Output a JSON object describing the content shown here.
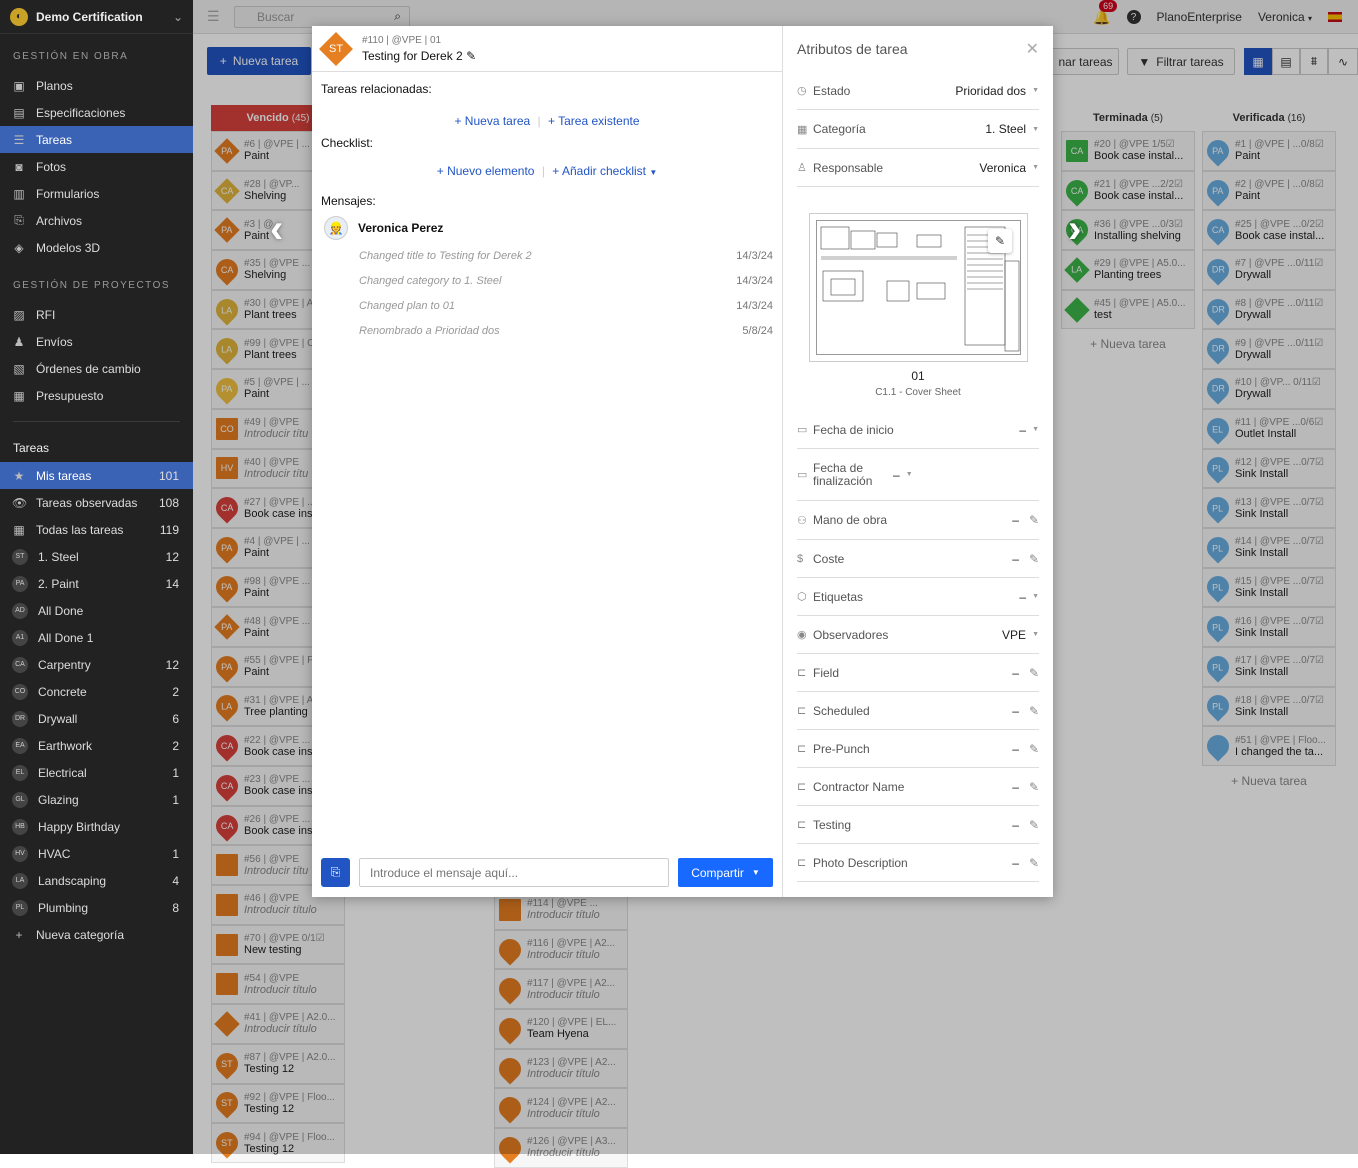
{
  "app": {
    "title": "Demo Certification"
  },
  "sidebar": {
    "sections": [
      {
        "title": "GESTIÓN EN OBRA",
        "items": [
          {
            "label": "Planos",
            "icon": "plans-icon"
          },
          {
            "label": "Especificaciones",
            "icon": "specs-icon"
          },
          {
            "label": "Tareas",
            "icon": "tasks-icon",
            "active": true
          },
          {
            "label": "Fotos",
            "icon": "camera-icon"
          },
          {
            "label": "Formularios",
            "icon": "forms-icon"
          },
          {
            "label": "Archivos",
            "icon": "paperclip-icon"
          },
          {
            "label": "Modelos 3D",
            "icon": "cube-icon"
          }
        ]
      },
      {
        "title": "GESTIÓN DE PROYECTOS",
        "items": [
          {
            "label": "RFI",
            "icon": "rfi-icon"
          },
          {
            "label": "Envíos",
            "icon": "user-icon"
          },
          {
            "label": "Órdenes de cambio",
            "icon": "change-order-icon"
          },
          {
            "label": "Presupuesto",
            "icon": "calculator-icon"
          }
        ]
      }
    ],
    "tasks_title": "Tareas",
    "task_filters": [
      {
        "label": "Mis tareas",
        "count": "101",
        "active": true,
        "icon": "★"
      },
      {
        "label": "Tareas observadas",
        "count": "108",
        "icon": "👁"
      },
      {
        "label": "Todas las tareas",
        "count": "119",
        "icon": "▦"
      }
    ],
    "categories": [
      {
        "abbr": "ST",
        "label": "1. Steel",
        "count": "12"
      },
      {
        "abbr": "PA",
        "label": "2. Paint",
        "count": "14"
      },
      {
        "abbr": "AD",
        "label": "All Done",
        "count": ""
      },
      {
        "abbr": "A1",
        "label": "All Done 1",
        "count": ""
      },
      {
        "abbr": "CA",
        "label": "Carpentry",
        "count": "12"
      },
      {
        "abbr": "CO",
        "label": "Concrete",
        "count": "2"
      },
      {
        "abbr": "DR",
        "label": "Drywall",
        "count": "6"
      },
      {
        "abbr": "EA",
        "label": "Earthwork",
        "count": "2"
      },
      {
        "abbr": "EL",
        "label": "Electrical",
        "count": "1"
      },
      {
        "abbr": "GL",
        "label": "Glazing",
        "count": "1"
      },
      {
        "abbr": "HB",
        "label": "Happy Birthday",
        "count": ""
      },
      {
        "abbr": "HV",
        "label": "HVAC",
        "count": "1"
      },
      {
        "abbr": "LA",
        "label": "Landscaping",
        "count": "4"
      },
      {
        "abbr": "PL",
        "label": "Plumbing",
        "count": "8"
      }
    ],
    "new_category": "Nueva categoría"
  },
  "topbar": {
    "search_placeholder": "Buscar",
    "notifications": "69",
    "org": "PlanoEnterprise",
    "user": "Veronica"
  },
  "toolbar": {
    "new_task": "Nueva tarea",
    "order_tasks": "nar tareas",
    "filter_tasks": "Filtrar tareas"
  },
  "columns": [
    {
      "title": "Vencido",
      "count": "(45)",
      "red": true,
      "cards": [
        {
          "abbr": "PA",
          "shape": "diamond",
          "color": "#e67e22",
          "meta": "#6 | @VPE | ...",
          "name": "Paint"
        },
        {
          "abbr": "CA",
          "shape": "diamond",
          "color": "#e0b43c",
          "meta": "#28 | @VP...",
          "name": "Shelving"
        },
        {
          "abbr": "PA",
          "shape": "diamond",
          "color": "#e67e22",
          "meta": "#3 | @",
          "name": "Paint"
        },
        {
          "abbr": "CA",
          "shape": "circle",
          "color": "#e67e22",
          "meta": "#35 | @VPE ...",
          "name": "Shelving"
        },
        {
          "abbr": "LA",
          "shape": "circle",
          "color": "#e0b43c",
          "meta": "#30 | @VPE | A",
          "name": "Plant trees"
        },
        {
          "abbr": "LA",
          "shape": "circle",
          "color": "#e0b43c",
          "meta": "#99 | @VPE | C",
          "name": "Plant trees"
        },
        {
          "abbr": "PA",
          "shape": "circle",
          "color": "#f0c040",
          "meta": "#5 | @VPE | ...",
          "name": "Paint"
        },
        {
          "abbr": "CO",
          "shape": "square",
          "color": "#e67e22",
          "meta": "#49 | @VPE",
          "name": "Introducir títu",
          "italic": true
        },
        {
          "abbr": "HV",
          "shape": "square",
          "color": "#e67e22",
          "meta": "#40 | @VPE",
          "name": "Introducir títu",
          "italic": true
        },
        {
          "abbr": "CA",
          "shape": "circle",
          "color": "#d9403b",
          "meta": "#27 | @VPE | ...",
          "name": "Book case ins"
        },
        {
          "abbr": "PA",
          "shape": "circle",
          "color": "#e67e22",
          "meta": "#4 | @VPE | ...",
          "name": "Paint"
        },
        {
          "abbr": "PA",
          "shape": "circle",
          "color": "#e67e22",
          "meta": "#98 | @VPE ...",
          "name": "Paint"
        },
        {
          "abbr": "PA",
          "shape": "diamond",
          "color": "#e67e22",
          "meta": "#48 | @VPE ...",
          "name": "Paint"
        },
        {
          "abbr": "PA",
          "shape": "circle",
          "color": "#e67e22",
          "meta": "#55 | @VPE | F",
          "name": "Paint"
        },
        {
          "abbr": "LA",
          "shape": "circle",
          "color": "#e67e22",
          "meta": "#31 | @VPE | A",
          "name": "Tree planting"
        },
        {
          "abbr": "CA",
          "shape": "circle",
          "color": "#d9403b",
          "meta": "#22 | @VPE ...",
          "name": "Book case ins"
        },
        {
          "abbr": "CA",
          "shape": "circle",
          "color": "#d9403b",
          "meta": "#23 | @VPE ...",
          "name": "Book case ins"
        },
        {
          "abbr": "CA",
          "shape": "circle",
          "color": "#d9403b",
          "meta": "#26 | @VPE ...",
          "name": "Book case ins"
        },
        {
          "abbr": "",
          "shape": "square",
          "color": "#e67e22",
          "meta": "#56 | @VPE",
          "name": "Introducir títu",
          "italic": true
        },
        {
          "abbr": "",
          "shape": "square",
          "color": "#e67e22",
          "meta": "#46 | @VPE",
          "name": "Introducir título",
          "italic": true
        },
        {
          "abbr": "",
          "shape": "square",
          "color": "#e67e22",
          "meta": "#70 | @VPE    0/1☑",
          "name": "New testing"
        },
        {
          "abbr": "",
          "shape": "square",
          "color": "#e67e22",
          "meta": "#54 | @VPE",
          "name": "Introducir título",
          "italic": true
        },
        {
          "abbr": "",
          "shape": "diamond",
          "color": "#e67e22",
          "meta": "#41 | @VPE | A2.0...",
          "name": "Introducir título",
          "italic": true
        },
        {
          "abbr": "ST",
          "shape": "circle",
          "color": "#e67e22",
          "meta": "#87 | @VPE | A2.0...",
          "name": "Testing 12"
        },
        {
          "abbr": "ST",
          "shape": "circle",
          "color": "#e67e22",
          "meta": "#92 | @VPE | Floo...",
          "name": "Testing 12"
        },
        {
          "abbr": "ST",
          "shape": "circle",
          "color": "#e67e22",
          "meta": "#94 | @VPE | Floo...",
          "name": "Testing 12"
        }
      ]
    },
    {
      "title": "",
      "count": "",
      "red": false,
      "cards": [
        {
          "abbr": "",
          "shape": "square",
          "color": "#e67e22",
          "meta": "#114 | @VPE ...",
          "name": "Introducir título",
          "italic": true
        },
        {
          "abbr": "",
          "shape": "circle",
          "color": "#e67e22",
          "meta": "#116 | @VPE | A2...",
          "name": "Introducir título",
          "italic": true
        },
        {
          "abbr": "",
          "shape": "circle",
          "color": "#e67e22",
          "meta": "#117 | @VPE | A2...",
          "name": "Introducir título",
          "italic": true
        },
        {
          "abbr": "",
          "shape": "circle",
          "color": "#e67e22",
          "meta": "#120 | @VPE | EL...",
          "name": "Team Hyena"
        },
        {
          "abbr": "",
          "shape": "circle",
          "color": "#e67e22",
          "meta": "#123 | @VPE | A2...",
          "name": "Introducir título",
          "italic": true
        },
        {
          "abbr": "",
          "shape": "circle",
          "color": "#e67e22",
          "meta": "#124 | @VPE | A2...",
          "name": "Introducir título",
          "italic": true
        },
        {
          "abbr": "",
          "shape": "circle",
          "color": "#e67e22",
          "meta": "#126 | @VPE | A3...",
          "name": "Introducir título",
          "italic": true
        }
      ]
    },
    {
      "title": "Terminada",
      "count": "(5)",
      "red": false,
      "cards": [
        {
          "abbr": "CA",
          "shape": "square",
          "color": "#3bb54a",
          "meta": "#20 | @VPE    1/5☑",
          "name": "Book case instal..."
        },
        {
          "abbr": "CA",
          "shape": "circle",
          "color": "#3bb54a",
          "meta": "#21 | @VPE ...2/2☑",
          "name": "Book case instal..."
        },
        {
          "abbr": "CA",
          "shape": "circle",
          "color": "#3bb54a",
          "meta": "#36 | @VPE ...0/3☑",
          "name": "Installing shelving"
        },
        {
          "abbr": "LA",
          "shape": "diamond",
          "color": "#3bb54a",
          "meta": "#29 | @VPE | A5.0...",
          "name": "Planting trees"
        },
        {
          "abbr": "",
          "shape": "diamond",
          "color": "#3bb54a",
          "meta": "#45 | @VPE | A5.0...",
          "name": "test"
        }
      ],
      "add": "+ Nueva tarea"
    },
    {
      "title": "Verificada",
      "count": "(16)",
      "red": false,
      "cards": [
        {
          "abbr": "PA",
          "shape": "circle",
          "color": "#6aaee0",
          "meta": "#1 | @VPE | ...0/8☑",
          "name": "Paint"
        },
        {
          "abbr": "PA",
          "shape": "circle",
          "color": "#6aaee0",
          "meta": "#2 | @VPE | ...0/8☑",
          "name": "Paint"
        },
        {
          "abbr": "CA",
          "shape": "circle",
          "color": "#6aaee0",
          "meta": "#25 | @VPE ...0/2☑",
          "name": "Book case instal..."
        },
        {
          "abbr": "DR",
          "shape": "circle",
          "color": "#6aaee0",
          "meta": "#7 | @VPE ...0/11☑",
          "name": "Drywall"
        },
        {
          "abbr": "DR",
          "shape": "circle",
          "color": "#6aaee0",
          "meta": "#8 | @VPE ...0/11☑",
          "name": "Drywall"
        },
        {
          "abbr": "DR",
          "shape": "circle",
          "color": "#6aaee0",
          "meta": "#9 | @VPE ...0/11☑",
          "name": "Drywall"
        },
        {
          "abbr": "DR",
          "shape": "circle",
          "color": "#6aaee0",
          "meta": "#10 | @VP... 0/11☑",
          "name": "Drywall"
        },
        {
          "abbr": "EL",
          "shape": "circle",
          "color": "#6aaee0",
          "meta": "#11 | @VPE ...0/6☑",
          "name": "Outlet Install"
        },
        {
          "abbr": "PL",
          "shape": "circle",
          "color": "#6aaee0",
          "meta": "#12 | @VPE ...0/7☑",
          "name": "Sink Install"
        },
        {
          "abbr": "PL",
          "shape": "circle",
          "color": "#6aaee0",
          "meta": "#13 | @VPE ...0/7☑",
          "name": "Sink Install"
        },
        {
          "abbr": "PL",
          "shape": "circle",
          "color": "#6aaee0",
          "meta": "#14 | @VPE ...0/7☑",
          "name": "Sink Install"
        },
        {
          "abbr": "PL",
          "shape": "circle",
          "color": "#6aaee0",
          "meta": "#15 | @VPE ...0/7☑",
          "name": "Sink Install"
        },
        {
          "abbr": "PL",
          "shape": "circle",
          "color": "#6aaee0",
          "meta": "#16 | @VPE ...0/7☑",
          "name": "Sink Install"
        },
        {
          "abbr": "PL",
          "shape": "circle",
          "color": "#6aaee0",
          "meta": "#17 | @VPE ...0/7☑",
          "name": "Sink Install"
        },
        {
          "abbr": "PL",
          "shape": "circle",
          "color": "#6aaee0",
          "meta": "#18 | @VPE ...0/7☑",
          "name": "Sink Install"
        },
        {
          "abbr": "",
          "shape": "circle",
          "color": "#6aaee0",
          "meta": "#51 | @VPE | Floo...",
          "name": "I changed the ta..."
        }
      ],
      "add": "+ Nueva tarea"
    }
  ],
  "modal": {
    "task_abbr": "ST",
    "task_meta": "#110 | @VPE | 01",
    "task_title": "Testing for Derek 2",
    "related_label": "Tareas relacionadas:",
    "new_task_link": "+ Nueva tarea",
    "existing_task_link": "+ Tarea existente",
    "checklist_label": "Checklist:",
    "new_item_link": "+ Nuevo elemento",
    "add_checklist_link": "+ Añadir checklist",
    "messages_label": "Mensajes:",
    "author": "Veronica Perez",
    "messages": [
      {
        "text": "Changed title to Testing for Derek 2",
        "date": "14/3/24"
      },
      {
        "text": "Changed category to 1. Steel",
        "date": "14/3/24"
      },
      {
        "text": "Changed plan to 01",
        "date": "14/3/24"
      },
      {
        "text": "Renombrado a Prioridad dos",
        "date": "5/8/24"
      }
    ],
    "message_placeholder": "Introduce el mensaje aquí...",
    "share_label": "Compartir",
    "attributes_title": "Atributos de tarea",
    "plan_name": "01",
    "plan_sheet": "C1.1 - Cover Sheet",
    "attrs_top": [
      {
        "icon": "◷",
        "label": "Estado",
        "value": "Prioridad dos",
        "type": "dd"
      },
      {
        "icon": "▦",
        "label": "Categoría",
        "value": "1. Steel",
        "type": "dd"
      },
      {
        "icon": "♙",
        "label": "Responsable",
        "value": "Veronica",
        "type": "dd"
      }
    ],
    "attrs_bottom": [
      {
        "icon": "▭",
        "label": "Fecha de inicio",
        "value": "–",
        "type": "dd"
      },
      {
        "icon": "▭",
        "label": "Fecha de finalización",
        "value": "–",
        "type": "dd"
      },
      {
        "icon": "⚇",
        "label": "Mano de obra",
        "value": "–",
        "type": "pen"
      },
      {
        "icon": "$",
        "label": "Coste",
        "value": "–",
        "type": "pen"
      },
      {
        "icon": "⬡",
        "label": "Etiquetas",
        "value": "–",
        "type": "dd"
      },
      {
        "icon": "◉",
        "label": "Observadores",
        "value": "VPE",
        "type": "dd"
      },
      {
        "icon": "⊏",
        "label": "Field",
        "value": "–",
        "type": "pen"
      },
      {
        "icon": "⊏",
        "label": "Scheduled",
        "value": "–",
        "type": "pen"
      },
      {
        "icon": "⊏",
        "label": "Pre-Punch",
        "value": "–",
        "type": "pen"
      },
      {
        "icon": "⊏",
        "label": "Contractor Name",
        "value": "–",
        "type": "pen"
      },
      {
        "icon": "⊏",
        "label": "Testing",
        "value": "–",
        "type": "pen"
      },
      {
        "icon": "⊏",
        "label": "Photo Description",
        "value": "–",
        "type": "pen"
      }
    ]
  }
}
